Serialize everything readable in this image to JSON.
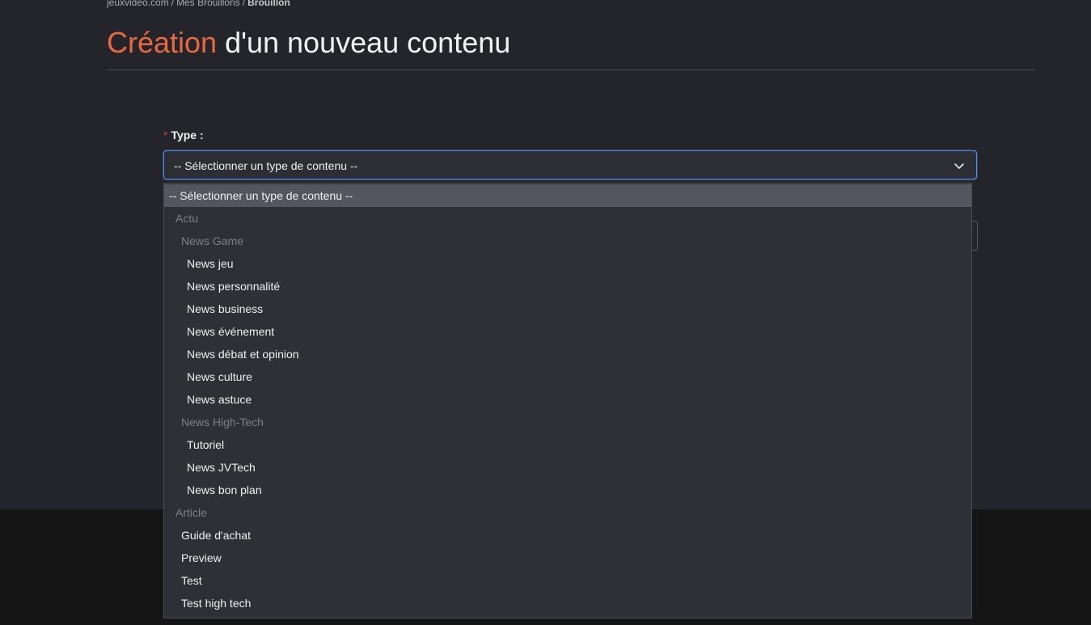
{
  "breadcrumb": {
    "items": [
      "jeuxvideo.com",
      "Mes Brouillons"
    ],
    "current": "Brouillon",
    "separator": "/"
  },
  "title": {
    "accent": "Création",
    "rest": " d'un nouveau contenu"
  },
  "form": {
    "type_label": "Type :",
    "required_mark": "*",
    "type_select": {
      "value": "-- Sélectionner un type de contenu --",
      "icon": "chevron-down-icon"
    }
  },
  "dropdown": {
    "placeholder": "-- Sélectionner un type de contenu --",
    "actu": {
      "label": "Actu",
      "news_game": {
        "label": "News Game",
        "options": [
          "News jeu",
          "News personnalité",
          "News business",
          "News événement",
          "News débat et opinion",
          "News culture",
          "News astuce"
        ]
      },
      "news_high_tech": {
        "label": "News High-Tech",
        "options": [
          "Tutoriel",
          "News JVTech",
          "News bon plan"
        ]
      }
    },
    "article": {
      "label": "Article",
      "options": [
        "Guide d'achat",
        "Preview",
        "Test",
        "Test high tech"
      ]
    }
  },
  "colors": {
    "accent": "#e8693e",
    "background": "#23252a",
    "focus_border": "#4d8fe8",
    "required": "#d93b3b"
  }
}
